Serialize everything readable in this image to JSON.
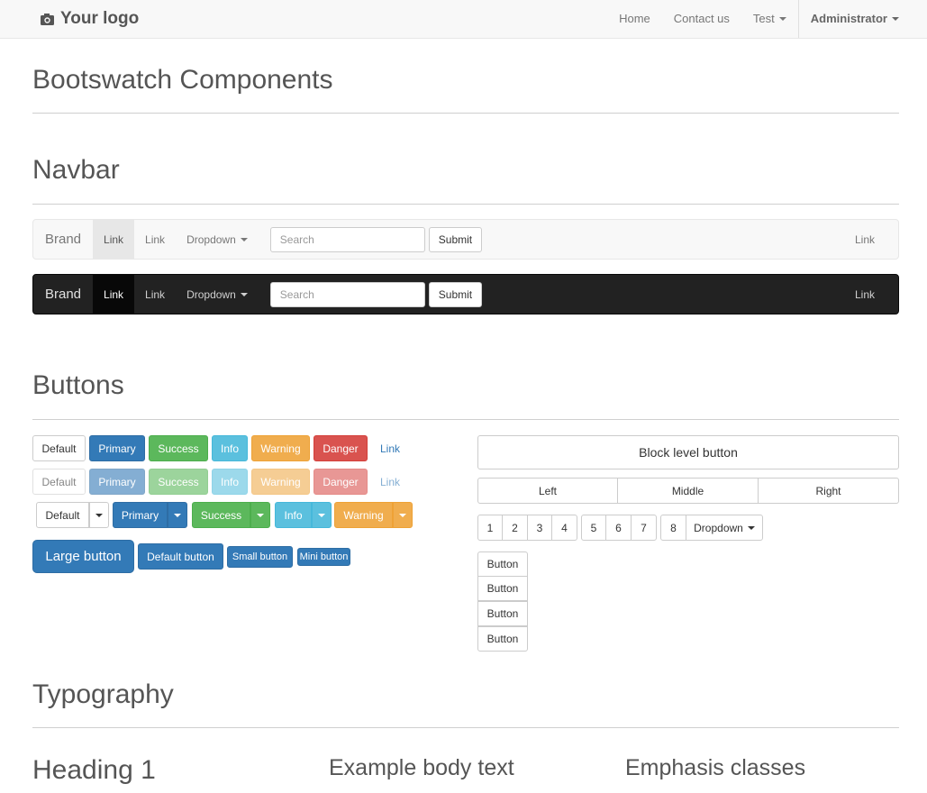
{
  "topbar": {
    "logo": "Your logo",
    "logo_icon": "camera-icon",
    "home": "Home",
    "contact": "Contact us",
    "test": "Test",
    "admin": "Administrator"
  },
  "page_title": "Bootswatch Components",
  "navbar_section": {
    "title": "Navbar",
    "light": {
      "brand": "Brand",
      "link_active": "Link",
      "link": "Link",
      "dropdown": "Dropdown",
      "search_placeholder": "Search",
      "submit": "Submit",
      "right_link": "Link"
    },
    "dark": {
      "brand": "Brand",
      "link_active": "Link",
      "link": "Link",
      "dropdown": "Dropdown",
      "search_placeholder": "Search",
      "submit": "Submit",
      "right_link": "Link"
    }
  },
  "buttons_section": {
    "title": "Buttons",
    "row1": [
      "Default",
      "Primary",
      "Success",
      "Info",
      "Warning",
      "Danger",
      "Link"
    ],
    "row2": [
      "Default",
      "Primary",
      "Success",
      "Info",
      "Warning",
      "Danger",
      "Link"
    ],
    "split": [
      "Default",
      "Primary",
      "Success",
      "Info",
      "Warning"
    ],
    "sizes": [
      "Large button",
      "Default button",
      "Small button",
      "Mini button"
    ],
    "block": "Block level button",
    "group": [
      "Left",
      "Middle",
      "Right"
    ],
    "pagination": [
      "1",
      "2",
      "3",
      "4",
      "5",
      "6",
      "7",
      "8"
    ],
    "pagination_dropdown": "Dropdown",
    "vertical": [
      "Button",
      "Button",
      "Button",
      "Button"
    ]
  },
  "typography_section": {
    "title": "Typography",
    "heading1": "Heading 1",
    "body_text": "Example body text",
    "emphasis": "Emphasis classes"
  },
  "colors": {
    "primary": "#337ab7",
    "success": "#5cb85c",
    "info": "#5bc0de",
    "warning": "#f0ad4e",
    "danger": "#d9534f"
  }
}
